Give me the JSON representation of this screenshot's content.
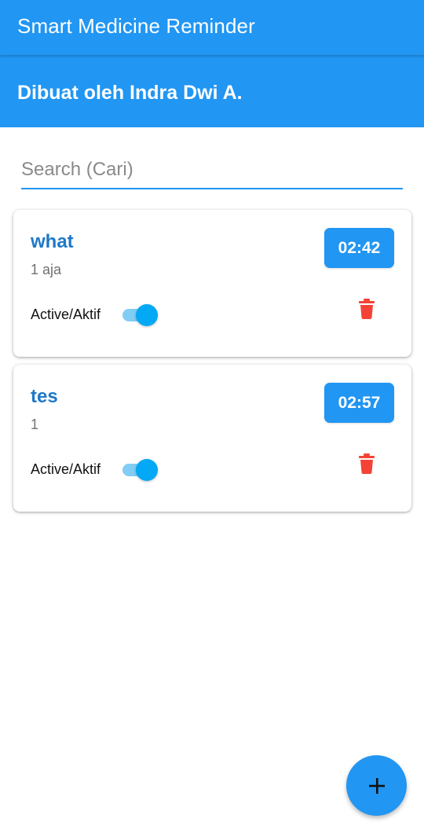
{
  "app_bar": {
    "title": "Smart Medicine Reminder"
  },
  "header": {
    "author": "Dibuat oleh Indra Dwi A."
  },
  "search": {
    "placeholder": "Search (Cari)",
    "value": ""
  },
  "reminders": [
    {
      "name": "what",
      "dose": "1 aja",
      "time": "02:42",
      "active_label": "Active/Aktif",
      "active": true
    },
    {
      "name": "tes",
      "dose": "1",
      "time": "02:57",
      "active_label": "Active/Aktif",
      "active": true
    }
  ],
  "icons": {
    "delete": "trash-icon",
    "fab": "add-icon"
  },
  "colors": {
    "primary": "#2196f3",
    "title_text": "#1e78c8",
    "switch_thumb": "#03a9f4",
    "switch_track": "#81cdf5",
    "delete": "#f44336"
  }
}
